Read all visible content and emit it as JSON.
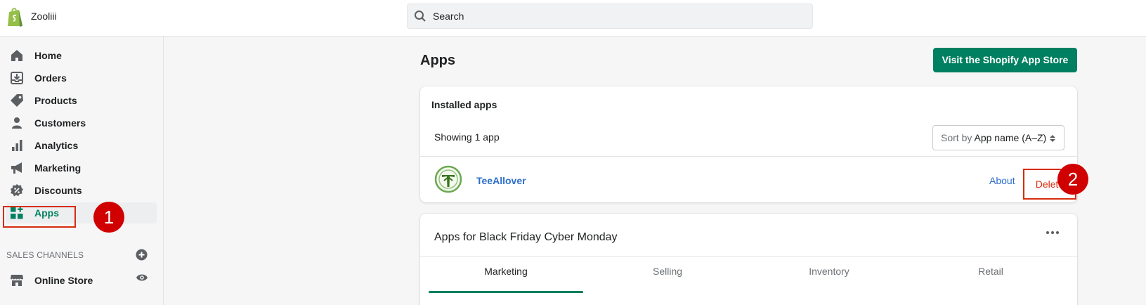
{
  "topbar": {
    "store_name": "Zooliii",
    "search_placeholder": "Search"
  },
  "sidebar": {
    "items": [
      {
        "label": "Home",
        "icon": "home-icon"
      },
      {
        "label": "Orders",
        "icon": "orders-icon"
      },
      {
        "label": "Products",
        "icon": "tag-icon"
      },
      {
        "label": "Customers",
        "icon": "person-icon"
      },
      {
        "label": "Analytics",
        "icon": "bar-chart-icon"
      },
      {
        "label": "Marketing",
        "icon": "megaphone-icon"
      },
      {
        "label": "Discounts",
        "icon": "discount-icon"
      },
      {
        "label": "Apps",
        "icon": "apps-icon",
        "active": true
      }
    ],
    "sales_channels_label": "SALES CHANNELS",
    "online_store_label": "Online Store"
  },
  "annotations": {
    "step1": "1",
    "step2": "2"
  },
  "main": {
    "title": "Apps",
    "visit_store_button": "Visit the Shopify App Store",
    "installed": {
      "title": "Installed apps",
      "showing": "Showing 1 app",
      "sort_prefix": "Sort by",
      "sort_value": "App name (A–Z)",
      "app_name": "TeeAllover",
      "about_label": "About",
      "delete_label": "Delete"
    },
    "promo": {
      "title": "Apps for Black Friday Cyber Monday",
      "tabs": [
        "Marketing",
        "Selling",
        "Inventory",
        "Retail"
      ],
      "active_tab": "Marketing"
    }
  },
  "colors": {
    "accent": "#008060",
    "link": "#2c6ecb",
    "critical": "#d72c0d",
    "badge": "#d10000"
  }
}
